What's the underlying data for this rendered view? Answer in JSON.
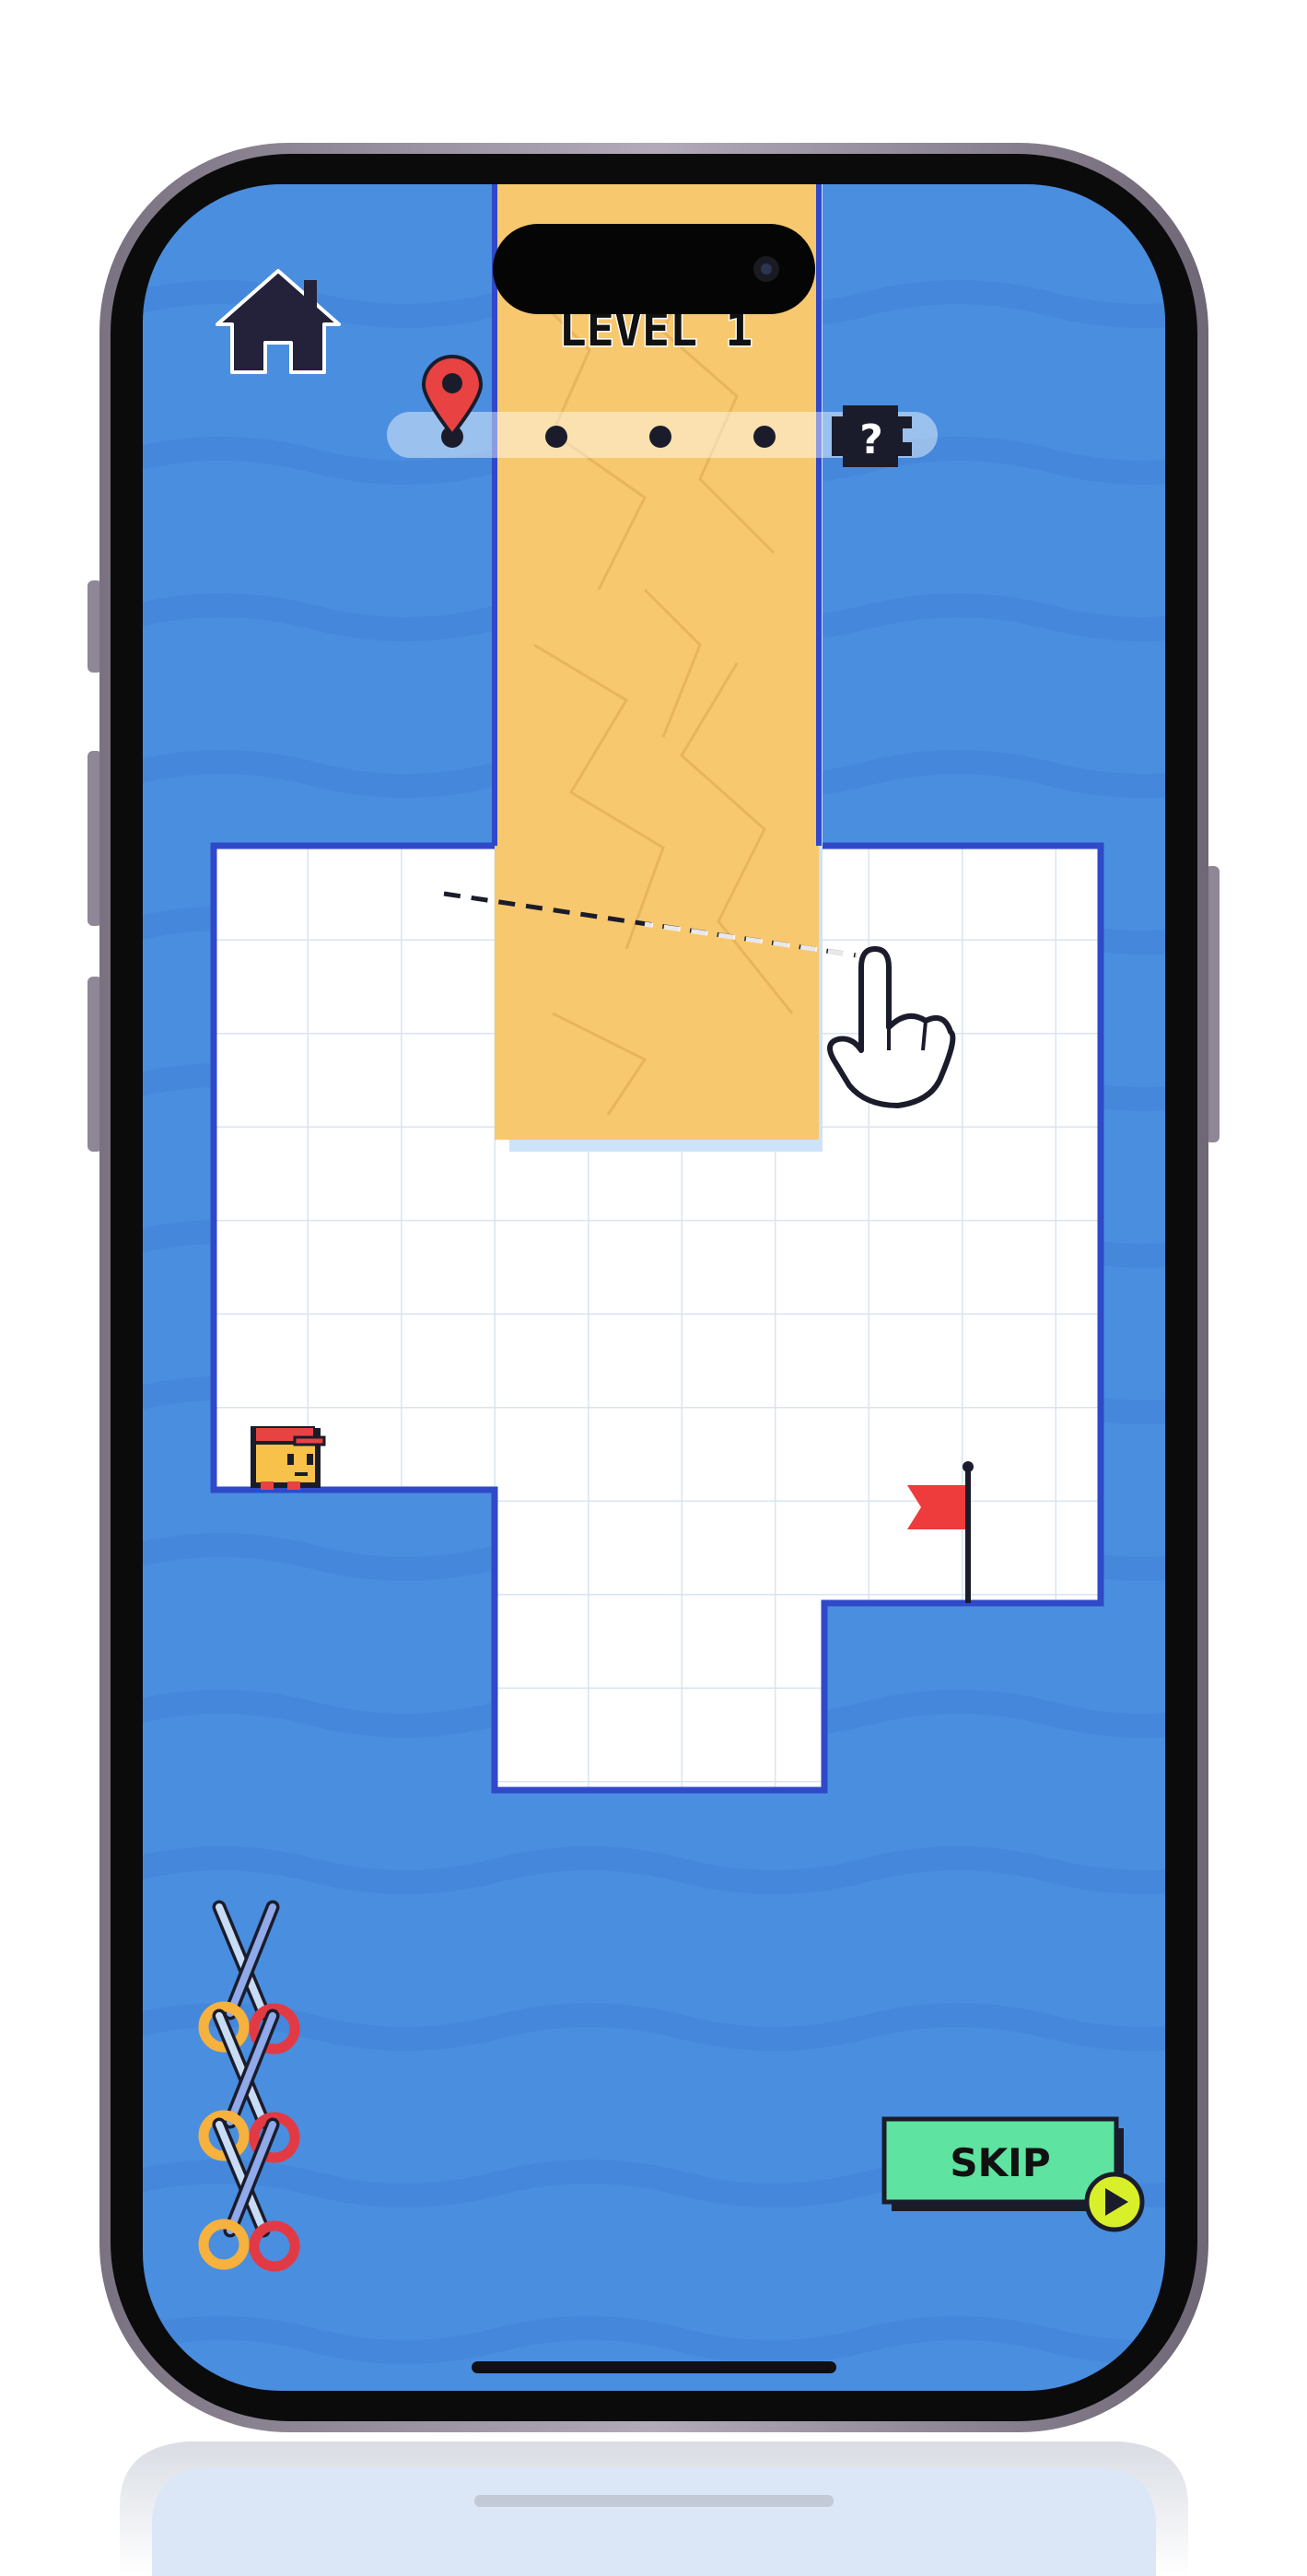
{
  "hud": {
    "level_title": "LEVEL 1",
    "progress_total_steps": 5,
    "progress_current_step": 1,
    "next_reward_symbol": "?"
  },
  "buttons": {
    "home_icon": "home-icon",
    "skip_label": "SKIP",
    "skip_icon": "play-icon"
  },
  "scissors": {
    "count": 3,
    "icon": "scissors-icon"
  },
  "colors": {
    "background": "#4a8ee0",
    "wave": "#4386da",
    "paper": "#f8c86e",
    "board": "#ffffff",
    "grid": "#d9e4f2",
    "outline": "#2f49c8",
    "skip_button": "#5ee3a0",
    "play_badge": "#d8f02a",
    "flag": "#ee3b3b"
  }
}
